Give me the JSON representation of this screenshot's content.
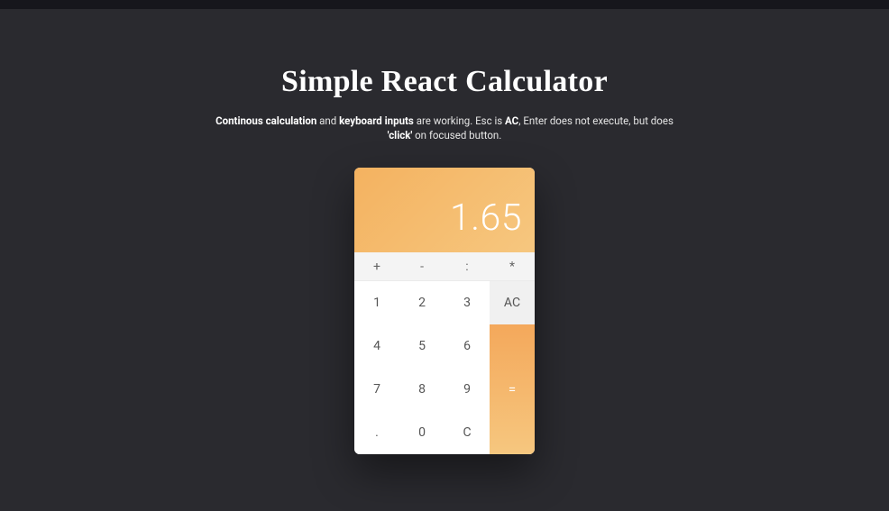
{
  "header": {
    "title": "Simple React Calculator",
    "subtitle_parts": {
      "b1": "Continous calculation",
      "t1": " and ",
      "b2": "keyboard inputs",
      "t2": " are working. Esc is ",
      "b3": "AC",
      "t3": ", Enter does not execute, but does ",
      "b4": "'click'",
      "t4": " on focused button."
    }
  },
  "calc": {
    "display": "1.65",
    "operators": {
      "add": "+",
      "sub": "-",
      "div": ":",
      "mul": "*"
    },
    "ac": "AC",
    "equals": "=",
    "pad": {
      "b1": "1",
      "b2": "2",
      "b3": "3",
      "b4": "4",
      "b5": "5",
      "b6": "6",
      "b7": "7",
      "b8": "8",
      "b9": "9",
      "dot": ".",
      "b0": "0",
      "clear": "C"
    }
  }
}
